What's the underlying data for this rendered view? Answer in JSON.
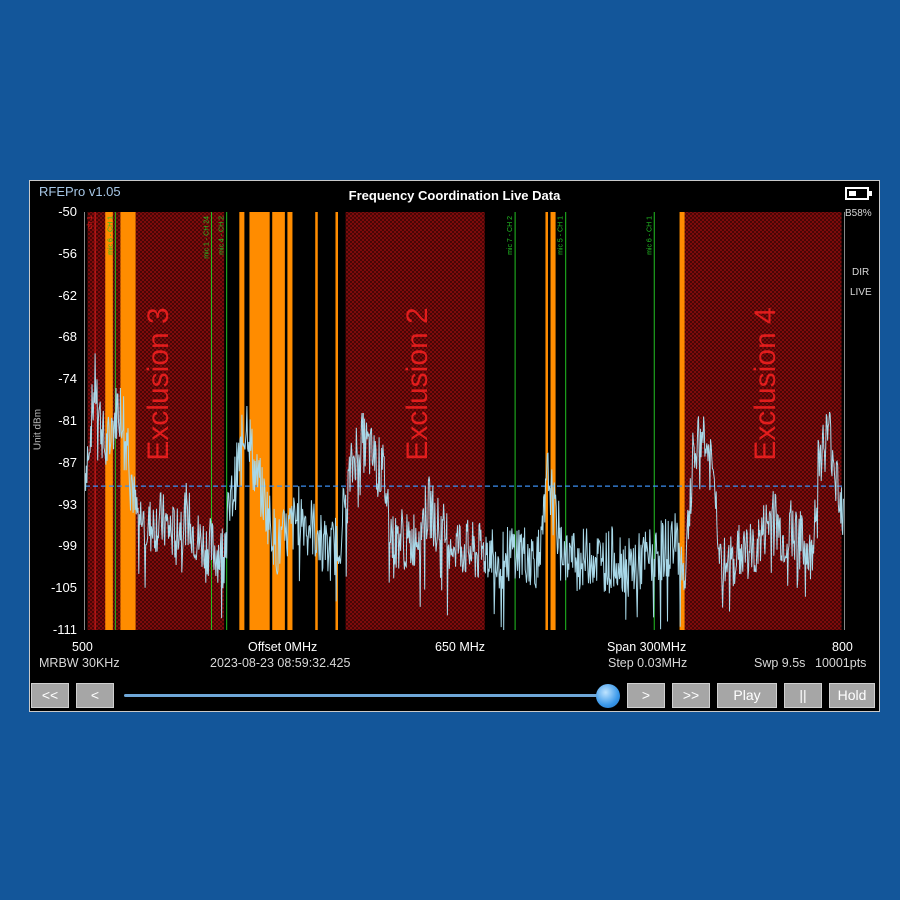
{
  "app": {
    "version": "RFEPro v1.05",
    "title": "Frequency Coordination Live Data",
    "battery": "B58%",
    "dir": "DIR",
    "live": "LIVE"
  },
  "status": {
    "rbw": "MRBW 30KHz",
    "offset": "Offset 0MHz",
    "timestamp": "2023-08-23 08:59:32.425",
    "center": "650 MHz",
    "span": "Span 300MHz",
    "step": "Step 0.03MHz",
    "sweep": "Swp 9.5s",
    "points": "10001pts",
    "x_start": "500",
    "x_end": "800"
  },
  "controls": {
    "first": "<<",
    "prev": "<",
    "next": ">",
    "last": ">>",
    "play": "Play",
    "pause": "||",
    "hold": "Hold",
    "slider_value": 1.0
  },
  "colors": {
    "background": "#13569a",
    "trace": "#a8d8e8",
    "exclusion": "#8c0c0c",
    "exclusion_text": "#e11d1d",
    "active_band": "#ff8c00",
    "marker": "#22c022",
    "threshold": "#3a8ef0"
  },
  "chart_data": {
    "type": "line",
    "title": "Frequency Coordination Live Data",
    "ylabel": "Unit dBm",
    "xlim": [
      500,
      800
    ],
    "ylim": [
      -111,
      -50
    ],
    "yticks": [
      "-50",
      "-56",
      "-62",
      "-68",
      "-74",
      "-81",
      "-87",
      "-93",
      "-99",
      "-105",
      "-111"
    ],
    "threshold_dbm": -90,
    "exclusions": [
      {
        "label": "Exclusion 3",
        "start": 501,
        "end": 555
      },
      {
        "label": "Exclusion 2",
        "start": 603,
        "end": 658
      },
      {
        "label": "Exclusion 4",
        "start": 737,
        "end": 799
      }
    ],
    "active_bands": [
      {
        "start": 508,
        "end": 511
      },
      {
        "start": 514,
        "end": 520
      },
      {
        "start": 561,
        "end": 563
      },
      {
        "start": 565,
        "end": 573
      },
      {
        "start": 574,
        "end": 579
      },
      {
        "start": 580,
        "end": 582
      },
      {
        "start": 591,
        "end": 592
      },
      {
        "start": 599,
        "end": 600
      },
      {
        "start": 682,
        "end": 683
      },
      {
        "start": 684,
        "end": 686
      },
      {
        "start": 735,
        "end": 737
      }
    ],
    "markers": [
      {
        "label": "ch 1",
        "freq": 504,
        "color": "#e11d1d"
      },
      {
        "label": "mic 6 - CH 1",
        "freq": 512,
        "color": "#22c022"
      },
      {
        "label": "mic 1 - CH 24",
        "freq": 550,
        "color": "#22c022"
      },
      {
        "label": "mic 4 - CH 2",
        "freq": 556,
        "color": "#22c022"
      },
      {
        "label": "mic 7 - CH 2",
        "freq": 670,
        "color": "#22c022"
      },
      {
        "label": "mic 5 - CH 1",
        "freq": 690,
        "color": "#22c022"
      },
      {
        "label": "mic 6 - CH 1",
        "freq": 725,
        "color": "#22c022"
      }
    ],
    "series": [
      {
        "x": [
          500,
          502,
          504,
          506,
          508,
          510,
          513,
          516,
          520,
          525,
          530,
          535,
          540,
          545,
          550,
          554,
          558,
          561,
          564,
          567,
          570,
          573,
          576,
          580,
          585,
          590,
          596,
          600,
          604,
          608,
          611,
          614,
          618,
          622,
          625,
          628,
          632,
          636,
          640,
          645,
          650,
          655,
          660,
          665,
          670,
          675,
          680,
          683,
          686,
          690,
          695,
          700,
          705,
          710,
          715,
          720,
          725,
          730,
          734,
          737,
          740,
          744,
          748,
          752,
          756,
          760,
          764,
          768,
          772,
          776,
          780,
          784,
          787,
          790,
          794,
          797,
          800
        ],
        "y": [
          -88,
          -82,
          -75,
          -80,
          -85,
          -83,
          -78,
          -80,
          -94,
          -96,
          -95,
          -97,
          -94,
          -98,
          -99,
          -100,
          -92,
          -86,
          -80,
          -88,
          -91,
          -95,
          -99,
          -97,
          -94,
          -96,
          -100,
          -98,
          -90,
          -83,
          -84,
          -86,
          -88,
          -99,
          -97,
          -99,
          -96,
          -93,
          -96,
          -98,
          -99,
          -100,
          -99,
          -101,
          -99,
          -100,
          -101,
          -88,
          -95,
          -100,
          -101,
          -100,
          -101,
          -100,
          -102,
          -101,
          -100,
          -99,
          -98,
          -103,
          -87,
          -82,
          -88,
          -102,
          -101,
          -99,
          -100,
          -97,
          -94,
          -98,
          -96,
          -99,
          -101,
          -86,
          -82,
          -88,
          -94
        ]
      }
    ]
  }
}
